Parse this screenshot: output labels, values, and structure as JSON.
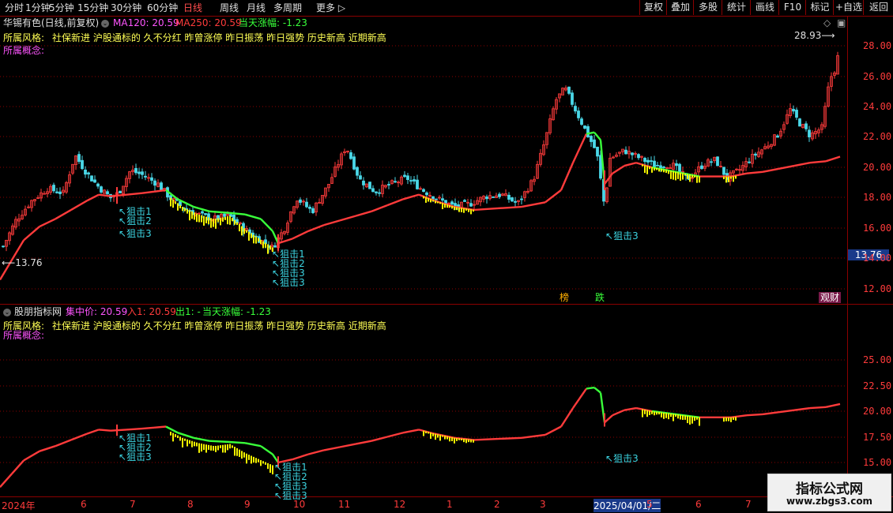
{
  "toolbar": {
    "tabs": [
      "分时",
      "1分钟",
      "5分钟",
      "15分钟",
      "30分钟",
      "60分钟",
      "日线",
      "周线",
      "月线",
      "多周期",
      "更多"
    ],
    "active_tab": "日线",
    "right_buttons": [
      "复权",
      "叠加",
      "多股",
      "统计",
      "画线",
      "F10",
      "标记",
      "+自选",
      "返回"
    ]
  },
  "panel1": {
    "stock_title": "华锡有色(日线,前复权)",
    "ma120": "MA120: 20.59",
    "ma250": "MA250: 20.59",
    "change": "当天涨幅: -1.23",
    "style_label": "所属风格:",
    "style_value": "社保新进 沪股通标的 久不分红 昨曾涨停 昨日振荡 昨日强势 历史新高 近期新高",
    "concept_label": "所属概念:",
    "high_marker": "28.93",
    "low_marker": "13.76",
    "price_tag": "13.76",
    "y_ticks": [
      "28.00",
      "26.00",
      "24.00",
      "22.00",
      "20.00",
      "18.00",
      "16.00",
      "14.00",
      "12.00"
    ],
    "badges": [
      "榜",
      "跌",
      "观财"
    ]
  },
  "panel2": {
    "indicator_title": "股朋指标网",
    "center": "集中价: 20.59",
    "in1": "入1: 20.59",
    "out1": "出1: -",
    "change": "当天涨幅: -1.23",
    "style_label": "所属风格:",
    "style_value": "社保新进 沪股通标的 久不分红 昨曾涨停 昨日振荡 昨日强势 历史新高 近期新高",
    "concept_label": "所属概念:",
    "y_ticks": [
      "25.00",
      "22.50",
      "20.00",
      "17.50",
      "15.00"
    ]
  },
  "signals": [
    "狙击1",
    "狙击2",
    "狙击3"
  ],
  "x_axis": {
    "labels": [
      "2024年",
      "6",
      "7",
      "8",
      "9",
      "10",
      "11",
      "12",
      "1",
      "2",
      "3",
      "2025/04/01/二",
      "5",
      "6",
      "7"
    ]
  },
  "watermark": {
    "title": "指标公式网",
    "url": "www.zbgs3.com"
  },
  "colors": {
    "up": "#ff3b3b",
    "down": "#4ad8e8",
    "green_line": "#39ff3a",
    "yellow_bar": "#f5f500",
    "cyan_text": "#3cd3e0",
    "yellow_text": "#ffff55",
    "magenta_text": "#ff55ff",
    "grid": "#8b0000"
  }
}
